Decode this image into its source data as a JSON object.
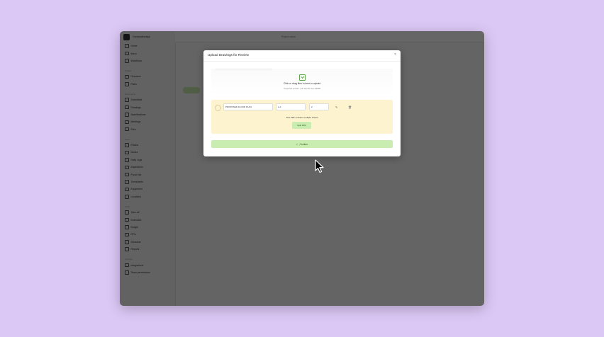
{
  "app": {
    "name": "ConstructionApp",
    "tab_title": "Project name"
  },
  "sidebar": {
    "items_top": [
      "Home",
      "Inbox",
      "Workflows"
    ],
    "section_1": "Project",
    "items_1": [
      "Overview",
      "Plans"
    ],
    "section_2": "Documents",
    "items_2": [
      "Submittals",
      "Drawings",
      "Specifications",
      "Meetings",
      "Files"
    ],
    "section_3": "Field",
    "items_3": [
      "Photos",
      "Issues",
      "Daily Logs",
      "Inspections",
      "Punch list",
      "Timesheets",
      "Equipment",
      "Locations"
    ],
    "section_4": "Tools",
    "items_4": [
      "Take-off",
      "Estimates",
      "Budget",
      "RFIs",
      "Schedule",
      "Reports"
    ],
    "section_5": "Settings",
    "items_5": [
      "Integrations",
      "Team permissions"
    ]
  },
  "modal": {
    "title": "Upload Drawings for Review",
    "close_glyph": "×",
    "dropzone": {
      "main": "Click or drag files in here to upload",
      "sub": "Supported formats: .pdf. Max file size 200MB"
    },
    "file": {
      "name": "PROPOSED FLOOR PLAN",
      "rev": "A-1",
      "count": "2",
      "message": "This PDF contains multiple sheets",
      "split_label": "Split PDF"
    },
    "confirm_label": "Confirm",
    "confirm_icon": "check-icon"
  },
  "colors": {
    "accent_green": "#c9ecb0",
    "file_row_bg": "#fdf4cf",
    "page_bg": "#dcc8f5"
  }
}
